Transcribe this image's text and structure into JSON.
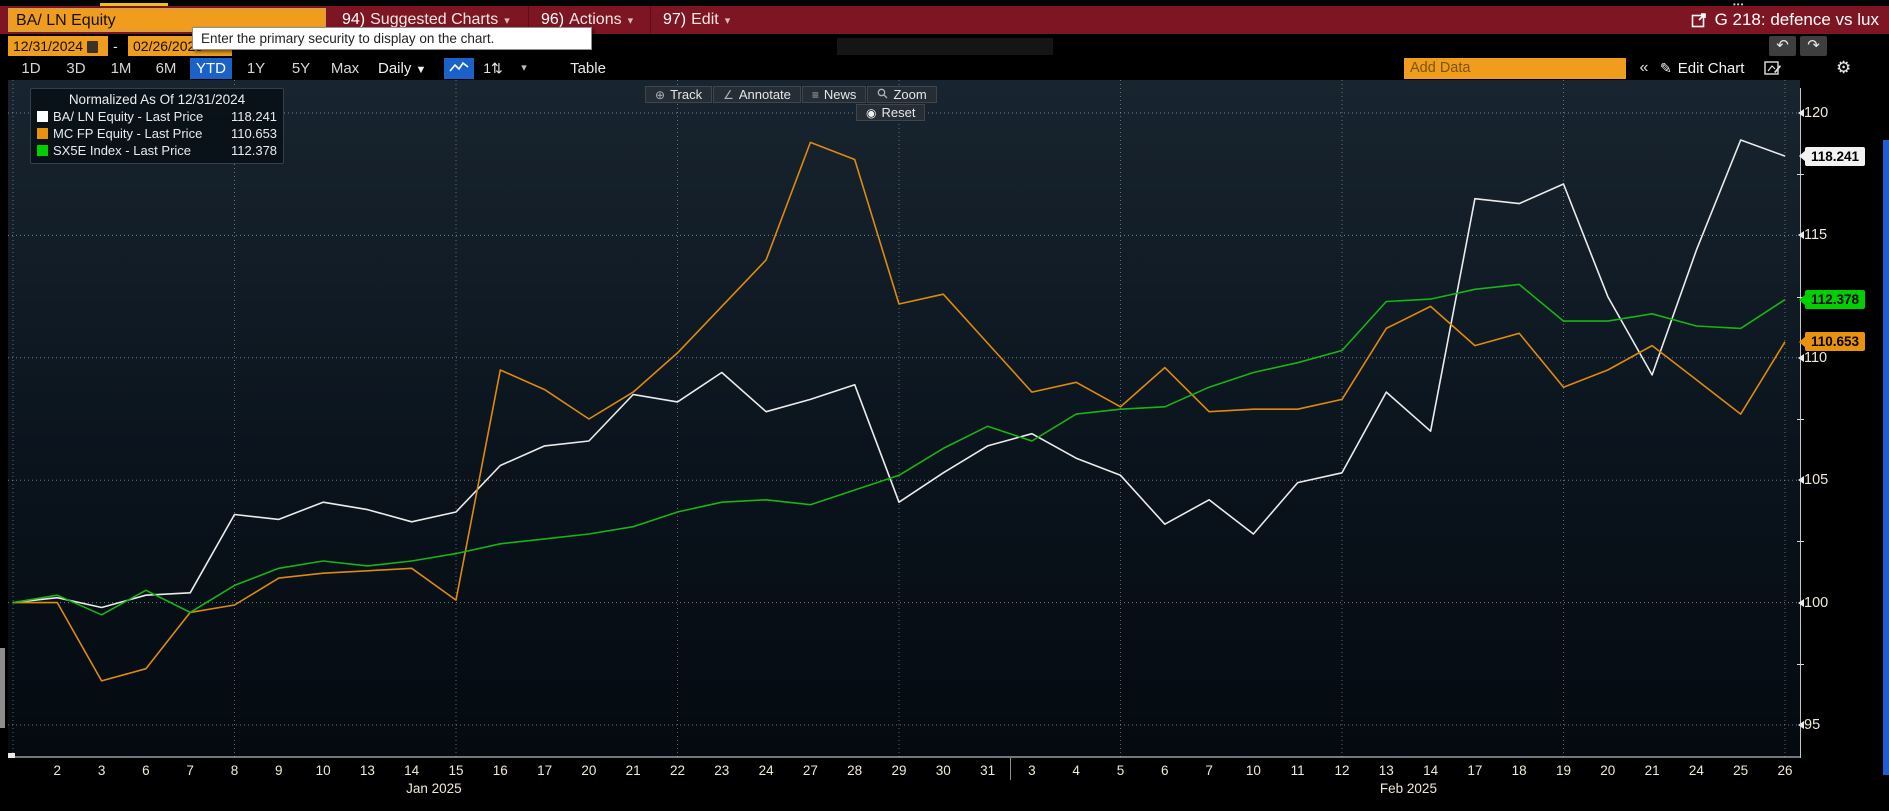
{
  "top_bar": {
    "security_input": "BA/ LN Equity",
    "menus": [
      {
        "num": "94)",
        "label": "Suggested Charts"
      },
      {
        "num": "96)",
        "label": "Actions"
      },
      {
        "num": "97)",
        "label": "Edit"
      }
    ],
    "chart_title": "G 218: defence vs lux"
  },
  "tooltip": {
    "text": "Enter the primary security to display on the chart."
  },
  "date_row": {
    "start_date": "12/31/2024",
    "dash": "-",
    "end_date": "02/26/2025"
  },
  "range_toolbar": {
    "ranges": [
      "1D",
      "3D",
      "1M",
      "6M",
      "YTD",
      "1Y",
      "5Y",
      "Max"
    ],
    "active_range": "YTD",
    "frequency": "Daily",
    "frequency_caret": "▼",
    "compare_icon_label": "1⇅",
    "small_caret": "▾",
    "table_label": "Table",
    "add_data_placeholder": "Add Data",
    "collapse_label": "«",
    "edit_chart_label": "Edit Chart"
  },
  "chart_toolbar": {
    "buttons": [
      "Track",
      "Annotate",
      "News",
      "Zoom"
    ],
    "reset_label": "Reset"
  },
  "legend": {
    "title": "Normalized As Of 12/31/2024",
    "items": [
      {
        "label": "BA/ LN Equity - Last Price",
        "value": "118.241",
        "color": "#ffffff"
      },
      {
        "label": "MC FP Equity - Last Price",
        "value": "110.653",
        "color": "#e8920d"
      },
      {
        "label": "SX5E Index - Last Price",
        "value": "112.378",
        "color": "#00d000"
      }
    ]
  },
  "chart_data": {
    "type": "line",
    "title": "Normalized As Of 12/31/2024",
    "xlabel": "",
    "ylabel": "",
    "ylim": [
      93.65,
      121.35
    ],
    "yticks": [
      95,
      100,
      105,
      110,
      115,
      120
    ],
    "yticks_minor": [
      97.5,
      102.5,
      107.5,
      112.5,
      117.5
    ],
    "grid": "dotted",
    "legend_position": "top-left",
    "x_labels": [
      "",
      "2",
      "3",
      "6",
      "7",
      "8",
      "9",
      "10",
      "13",
      "14",
      "15",
      "16",
      "17",
      "20",
      "21",
      "22",
      "23",
      "24",
      "27",
      "28",
      "29",
      "30",
      "31",
      "3",
      "4",
      "5",
      "6",
      "7",
      "10",
      "11",
      "12",
      "13",
      "14",
      "17",
      "18",
      "19",
      "20",
      "21",
      "24",
      "25",
      "26"
    ],
    "month_labels": [
      {
        "text": "Jan 2025",
        "index": 9.5
      },
      {
        "text": "Feb 2025",
        "index": 31.5
      }
    ],
    "vgrid_indices": [
      0,
      5,
      10,
      15,
      20,
      25,
      30,
      35,
      40
    ],
    "series": [
      {
        "name": "BA/ LN Equity - Last Price",
        "color": "#ebebeb",
        "values": [
          100,
          100.2,
          99.8,
          100.3,
          100.4,
          103.6,
          103.4,
          104.1,
          103.8,
          103.3,
          103.7,
          105.6,
          106.4,
          106.6,
          108.5,
          108.2,
          109.4,
          107.8,
          108.3,
          108.9,
          104.1,
          105.3,
          106.4,
          106.9,
          105.9,
          105.2,
          103.2,
          104.2,
          102.8,
          104.9,
          105.3,
          108.6,
          107.0,
          116.5,
          116.3,
          117.1,
          112.5,
          109.3,
          114.4,
          118.9,
          118.241
        ]
      },
      {
        "name": "MC FP Equity - Last Price",
        "color": "#de8a0d",
        "values": [
          100,
          100.0,
          96.8,
          97.3,
          99.6,
          99.9,
          101.0,
          101.2,
          101.3,
          101.4,
          100.1,
          109.5,
          108.7,
          107.5,
          108.6,
          110.2,
          112.1,
          114.0,
          118.8,
          118.1,
          112.2,
          112.6,
          110.6,
          108.6,
          109.0,
          108.0,
          109.6,
          107.8,
          107.9,
          107.9,
          108.3,
          111.2,
          112.1,
          110.5,
          111.0,
          108.8,
          109.5,
          110.5,
          109.1,
          107.7,
          110.653
        ]
      },
      {
        "name": "SX5E Index - Last Price",
        "color": "#17b417",
        "values": [
          100,
          100.3,
          99.5,
          100.5,
          99.6,
          100.7,
          101.4,
          101.7,
          101.5,
          101.7,
          102.0,
          102.4,
          102.6,
          102.8,
          103.1,
          103.7,
          104.1,
          104.2,
          104.0,
          104.6,
          105.2,
          106.3,
          107.2,
          106.6,
          107.7,
          107.9,
          108.0,
          108.8,
          109.4,
          109.8,
          110.3,
          112.3,
          112.4,
          112.8,
          113.0,
          111.5,
          111.5,
          111.8,
          111.3,
          111.2,
          112.378
        ]
      }
    ],
    "end_tags": [
      {
        "label": "118.241",
        "value": 118.241,
        "bg": "#f2f2f2",
        "fg": "#000000"
      },
      {
        "label": "112.378",
        "value": 112.378,
        "bg": "#00cf00",
        "fg": "#000000"
      },
      {
        "label": "110.653",
        "value": 110.653,
        "bg": "#e8920d",
        "fg": "#000000"
      }
    ]
  }
}
